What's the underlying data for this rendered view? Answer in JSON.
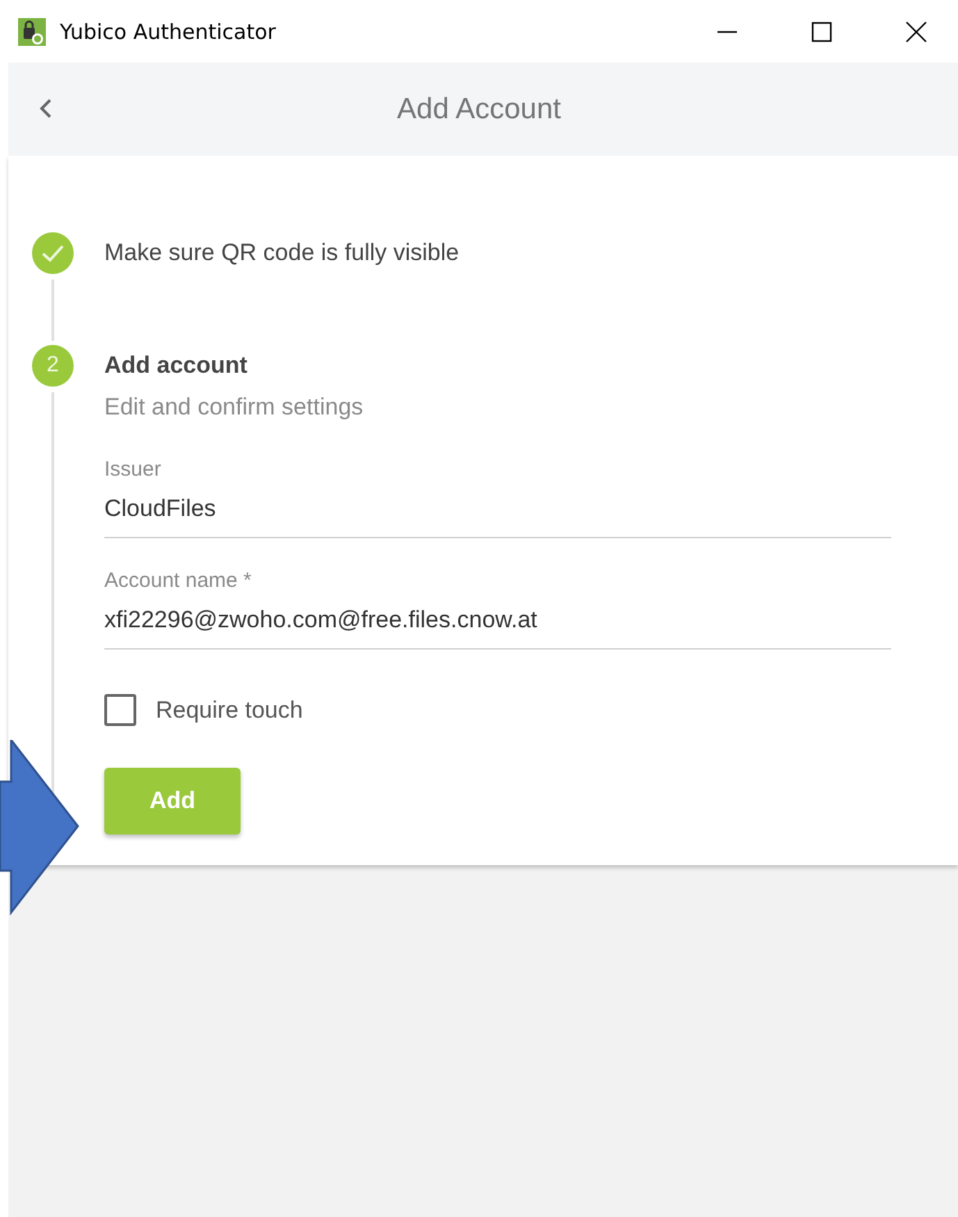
{
  "window": {
    "title": "Yubico Authenticator"
  },
  "header": {
    "title": "Add Account"
  },
  "steps": [
    {
      "kind": "done",
      "title": "Make sure QR code is fully visible"
    },
    {
      "kind": "active",
      "number": "2",
      "title": "Add account",
      "subtitle": "Edit and confirm settings"
    }
  ],
  "fields": [
    {
      "label": "Issuer",
      "value": "CloudFiles"
    },
    {
      "label": "Account name *",
      "value": "xfi22296@zwoho.com@free.files.cnow.at"
    }
  ],
  "require_touch": {
    "label": "Require touch",
    "checked": false
  },
  "add_button": {
    "label": "Add"
  }
}
